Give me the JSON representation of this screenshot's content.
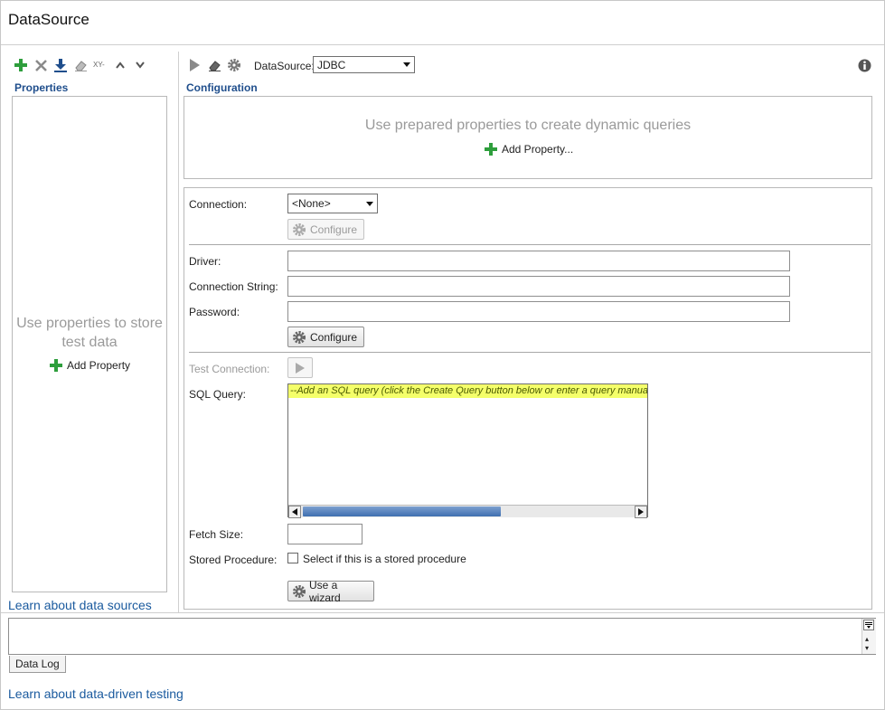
{
  "window": {
    "title": "DataSource"
  },
  "left_toolbar": {
    "icons": [
      "add-icon",
      "delete-icon",
      "download-icon",
      "eraser-icon",
      "xy-icon",
      "chevron-up-icon",
      "chevron-down-icon"
    ],
    "xy_text": "XY-"
  },
  "properties": {
    "header": "Properties",
    "empty_message": "Use properties to store test data",
    "add_label": "Add Property"
  },
  "left_footer": {
    "link": "Learn about data sources"
  },
  "right_toolbar": {
    "datasource_label": "DataSource:",
    "datasource_value": "JDBC"
  },
  "configuration": {
    "header": "Configuration",
    "prepared_message": "Use prepared properties to create dynamic queries",
    "add_property_label": "Add Property..."
  },
  "connection": {
    "label": "Connection:",
    "value": "<None>",
    "configure_label": "Configure"
  },
  "driver_fields": {
    "driver_label": "Driver:",
    "driver_value": "",
    "connstr_label": "Connection String:",
    "connstr_value": "",
    "password_label": "Password:",
    "password_value": "",
    "configure_label": "Configure"
  },
  "query": {
    "test_label": "Test Connection:",
    "sql_label": "SQL Query:",
    "sql_text": "--Add an SQL query (click the Create Query button below or enter a query manua",
    "scroll_fraction": 0.6,
    "fetch_label": "Fetch Size:",
    "fetch_value": "",
    "stored_label": "Stored Procedure:",
    "stored_checkbox_label": "Select if this is a stored procedure",
    "stored_checked": false,
    "wizard_label": "Use a wizard"
  },
  "log": {
    "tab_label": "Data Log"
  },
  "bottom": {
    "link": "Learn about data-driven testing"
  },
  "colors": {
    "accent": "#1f4e8c",
    "link": "#1a5a9e",
    "add_green": "#2e9e3c",
    "sql_bg": "#f4ff6a"
  }
}
